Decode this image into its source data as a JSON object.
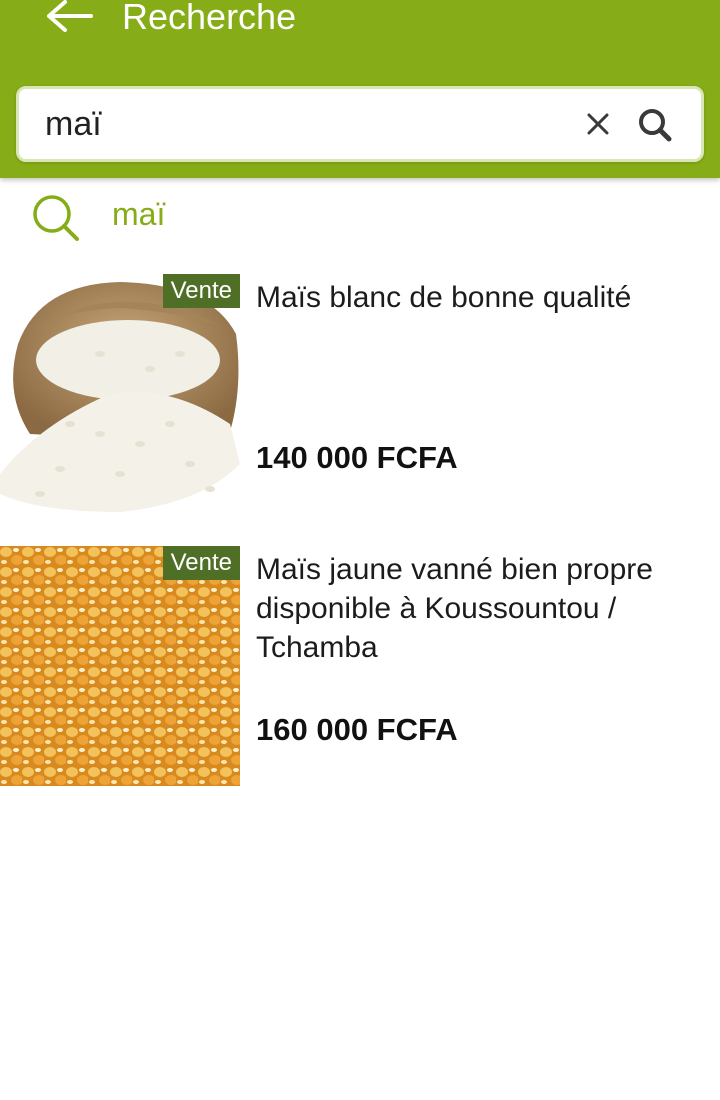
{
  "header": {
    "title": "Recherche",
    "background_color": "#86ac17",
    "back_icon": "arrow-left-icon"
  },
  "search": {
    "value": "maï",
    "clear_icon": "close-icon",
    "submit_icon": "search-icon"
  },
  "suggestion": {
    "text": "maï",
    "icon": "search-icon",
    "color": "#86ac17"
  },
  "results": [
    {
      "badge": "Vente",
      "title": "Maïs blanc de bonne qualité",
      "price": "140 000 FCFA",
      "image": "white-maize-sack"
    },
    {
      "badge": "Vente",
      "title": "Maïs jaune vanné bien propre disponible à Koussountou / Tchamba",
      "price": "160 000 FCFA",
      "image": "yellow-maize-kernels"
    }
  ]
}
